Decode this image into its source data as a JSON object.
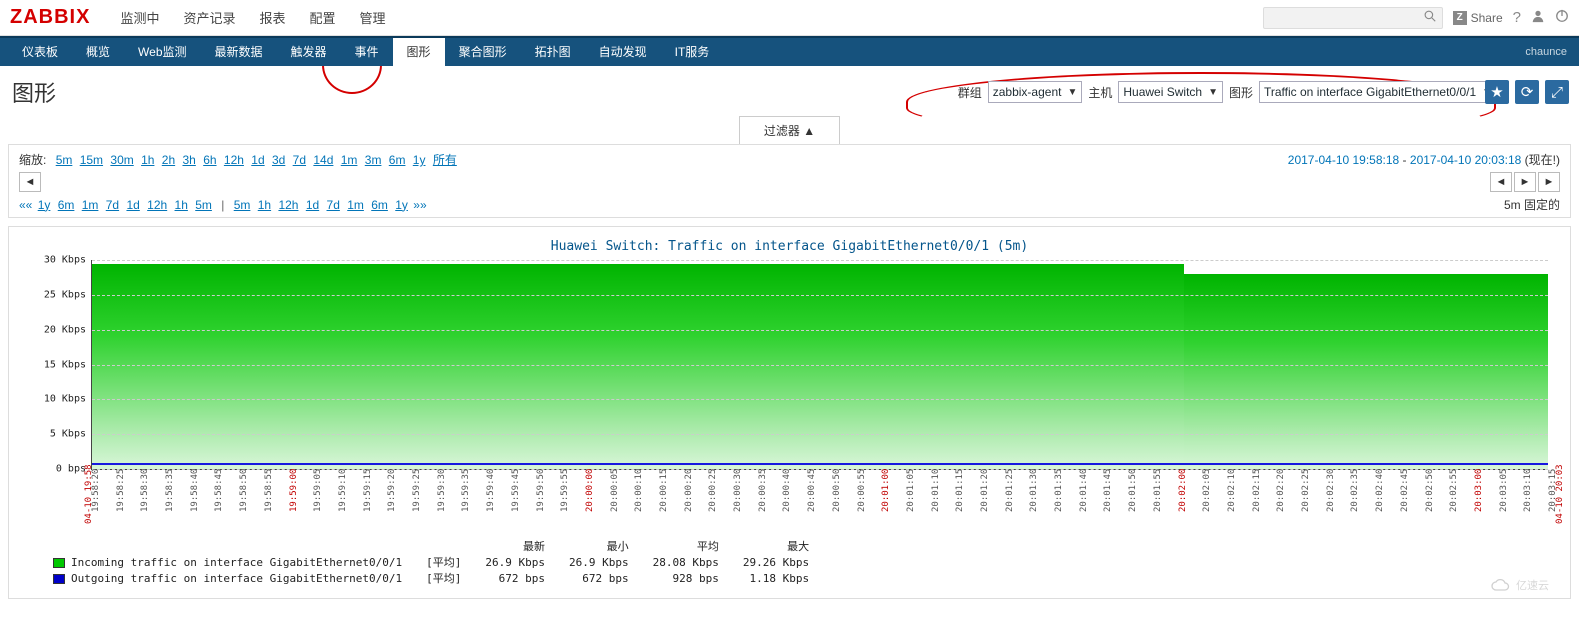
{
  "logo": "ZABBIX",
  "main_nav": {
    "items": [
      "监测中",
      "资产记录",
      "报表",
      "配置",
      "管理"
    ]
  },
  "top_right": {
    "share": "Share",
    "share_badge": "Z"
  },
  "sub_nav": {
    "items": [
      "仪表板",
      "概览",
      "Web监测",
      "最新数据",
      "触发器",
      "事件",
      "图形",
      "聚合图形",
      "拓扑图",
      "自动发现",
      "IT服务"
    ],
    "active_index": 6,
    "username": "chaunce"
  },
  "page_title": "图形",
  "filters": {
    "group_label": "群组",
    "group_value": "zabbix-agent",
    "host_label": "主机",
    "host_value": "Huawei Switch",
    "graph_label": "图形",
    "graph_value": "Traffic on interface GigabitEthernet0/0/1"
  },
  "filter_tab": "过滤器 ▲",
  "zoom": {
    "label": "缩放:",
    "options": [
      "5m",
      "15m",
      "30m",
      "1h",
      "2h",
      "3h",
      "6h",
      "12h",
      "1d",
      "3d",
      "7d",
      "14d",
      "1m",
      "3m",
      "6m",
      "1y",
      "所有"
    ],
    "range_from": "2017-04-10 19:58:18",
    "range_to": "2017-04-10 20:03:18",
    "now_label": "(现在!)",
    "shift_left": [
      "1y",
      "6m",
      "1m",
      "7d",
      "1d",
      "12h",
      "1h",
      "5m"
    ],
    "shift_right": [
      "5m",
      "1h",
      "12h",
      "1d",
      "7d",
      "1m",
      "6m",
      "1y"
    ],
    "fixed_label": "5m 固定的"
  },
  "chart_data": {
    "type": "area",
    "title": "Huawei Switch: Traffic on interface GigabitEthernet0/0/1 (5m)",
    "ylabel_unit": "Kbps",
    "ylim": [
      0,
      30
    ],
    "y_ticks": [
      {
        "v": 0,
        "label": "0 bps"
      },
      {
        "v": 5,
        "label": "5 Kbps"
      },
      {
        "v": 10,
        "label": "10 Kbps"
      },
      {
        "v": 15,
        "label": "15 Kbps"
      },
      {
        "v": 20,
        "label": "20 Kbps"
      },
      {
        "v": 25,
        "label": "25 Kbps"
      },
      {
        "v": 30,
        "label": "30 Kbps"
      }
    ],
    "x_edge_left": "04-10 19:58",
    "x_edge_right": "04-10 20:03",
    "x_ticks": [
      "19:58:20",
      "19:58:25",
      "19:58:30",
      "19:58:35",
      "19:58:40",
      "19:58:45",
      "19:58:50",
      "19:58:55",
      "19:59:00",
      "19:59:05",
      "19:59:10",
      "19:59:15",
      "19:59:20",
      "19:59:25",
      "19:59:30",
      "19:59:35",
      "19:59:40",
      "19:59:45",
      "19:59:50",
      "19:59:55",
      "20:00:00",
      "20:00:05",
      "20:00:10",
      "20:00:15",
      "20:00:20",
      "20:00:25",
      "20:00:30",
      "20:00:35",
      "20:00:40",
      "20:00:45",
      "20:00:50",
      "20:00:55",
      "20:01:00",
      "20:01:05",
      "20:01:10",
      "20:01:15",
      "20:01:20",
      "20:01:25",
      "20:01:30",
      "20:01:35",
      "20:01:40",
      "20:01:45",
      "20:01:50",
      "20:01:55",
      "20:02:00",
      "20:02:05",
      "20:02:10",
      "20:02:15",
      "20:02:20",
      "20:02:25",
      "20:02:30",
      "20:02:35",
      "20:02:40",
      "20:02:45",
      "20:02:50",
      "20:02:55",
      "20:03:00",
      "20:03:05",
      "20:03:10",
      "20:03:15"
    ],
    "x_major": [
      "19:59:00",
      "20:00:00",
      "20:01:00",
      "20:02:00",
      "20:03:00"
    ],
    "series": [
      {
        "name": "Incoming traffic on interface GigabitEthernet0/0/1",
        "color": "#00c800",
        "approx_values_kbps": {
          "start": 29.2,
          "end": 27.5
        }
      },
      {
        "name": "Outgoing traffic on interface GigabitEthernet0/0/1",
        "color": "#0000c8",
        "approx_values_kbps": {
          "start": 0.9,
          "end": 0.9
        }
      }
    ]
  },
  "legend": {
    "headers": [
      "最新",
      "最小",
      "平均",
      "最大"
    ],
    "agg_label": "[平均]",
    "rows": [
      {
        "swatch": "green",
        "name": "Incoming traffic on interface GigabitEthernet0/0/1",
        "last": "26.9 Kbps",
        "min": "26.9 Kbps",
        "avg": "28.08 Kbps",
        "max": "29.26 Kbps"
      },
      {
        "swatch": "blue",
        "name": "Outgoing traffic on interface GigabitEthernet0/0/1",
        "last": "672 bps",
        "min": "672 bps",
        "avg": "928 bps",
        "max": "1.18 Kbps"
      }
    ]
  },
  "footer_brand": "亿速云"
}
